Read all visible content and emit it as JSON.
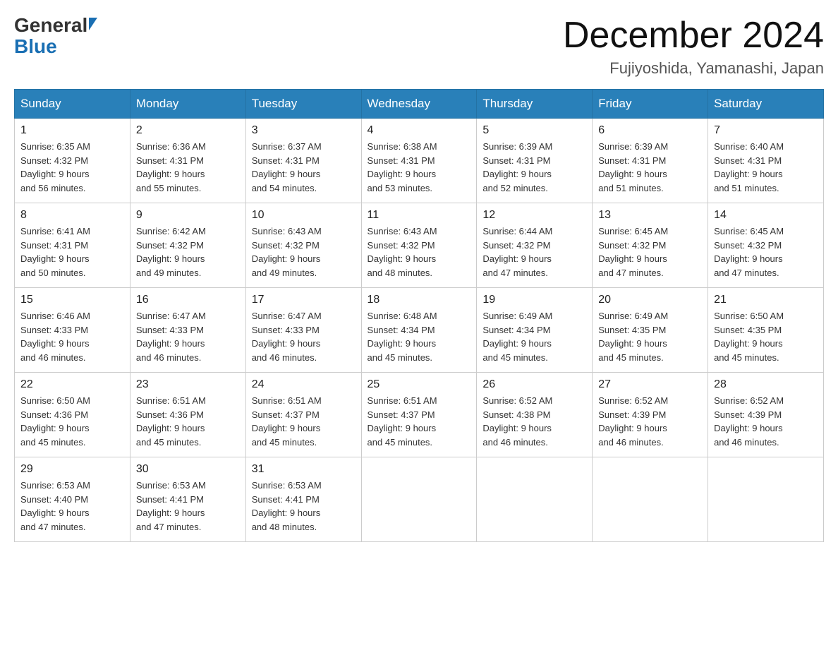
{
  "logo": {
    "general": "General",
    "blue": "Blue"
  },
  "title": {
    "month": "December 2024",
    "location": "Fujiyoshida, Yamanashi, Japan"
  },
  "days_of_week": [
    "Sunday",
    "Monday",
    "Tuesday",
    "Wednesday",
    "Thursday",
    "Friday",
    "Saturday"
  ],
  "weeks": [
    [
      {
        "day": "1",
        "sunrise": "6:35 AM",
        "sunset": "4:32 PM",
        "daylight": "9 hours and 56 minutes."
      },
      {
        "day": "2",
        "sunrise": "6:36 AM",
        "sunset": "4:31 PM",
        "daylight": "9 hours and 55 minutes."
      },
      {
        "day": "3",
        "sunrise": "6:37 AM",
        "sunset": "4:31 PM",
        "daylight": "9 hours and 54 minutes."
      },
      {
        "day": "4",
        "sunrise": "6:38 AM",
        "sunset": "4:31 PM",
        "daylight": "9 hours and 53 minutes."
      },
      {
        "day": "5",
        "sunrise": "6:39 AM",
        "sunset": "4:31 PM",
        "daylight": "9 hours and 52 minutes."
      },
      {
        "day": "6",
        "sunrise": "6:39 AM",
        "sunset": "4:31 PM",
        "daylight": "9 hours and 51 minutes."
      },
      {
        "day": "7",
        "sunrise": "6:40 AM",
        "sunset": "4:31 PM",
        "daylight": "9 hours and 51 minutes."
      }
    ],
    [
      {
        "day": "8",
        "sunrise": "6:41 AM",
        "sunset": "4:31 PM",
        "daylight": "9 hours and 50 minutes."
      },
      {
        "day": "9",
        "sunrise": "6:42 AM",
        "sunset": "4:32 PM",
        "daylight": "9 hours and 49 minutes."
      },
      {
        "day": "10",
        "sunrise": "6:43 AM",
        "sunset": "4:32 PM",
        "daylight": "9 hours and 49 minutes."
      },
      {
        "day": "11",
        "sunrise": "6:43 AM",
        "sunset": "4:32 PM",
        "daylight": "9 hours and 48 minutes."
      },
      {
        "day": "12",
        "sunrise": "6:44 AM",
        "sunset": "4:32 PM",
        "daylight": "9 hours and 47 minutes."
      },
      {
        "day": "13",
        "sunrise": "6:45 AM",
        "sunset": "4:32 PM",
        "daylight": "9 hours and 47 minutes."
      },
      {
        "day": "14",
        "sunrise": "6:45 AM",
        "sunset": "4:32 PM",
        "daylight": "9 hours and 47 minutes."
      }
    ],
    [
      {
        "day": "15",
        "sunrise": "6:46 AM",
        "sunset": "4:33 PM",
        "daylight": "9 hours and 46 minutes."
      },
      {
        "day": "16",
        "sunrise": "6:47 AM",
        "sunset": "4:33 PM",
        "daylight": "9 hours and 46 minutes."
      },
      {
        "day": "17",
        "sunrise": "6:47 AM",
        "sunset": "4:33 PM",
        "daylight": "9 hours and 46 minutes."
      },
      {
        "day": "18",
        "sunrise": "6:48 AM",
        "sunset": "4:34 PM",
        "daylight": "9 hours and 45 minutes."
      },
      {
        "day": "19",
        "sunrise": "6:49 AM",
        "sunset": "4:34 PM",
        "daylight": "9 hours and 45 minutes."
      },
      {
        "day": "20",
        "sunrise": "6:49 AM",
        "sunset": "4:35 PM",
        "daylight": "9 hours and 45 minutes."
      },
      {
        "day": "21",
        "sunrise": "6:50 AM",
        "sunset": "4:35 PM",
        "daylight": "9 hours and 45 minutes."
      }
    ],
    [
      {
        "day": "22",
        "sunrise": "6:50 AM",
        "sunset": "4:36 PM",
        "daylight": "9 hours and 45 minutes."
      },
      {
        "day": "23",
        "sunrise": "6:51 AM",
        "sunset": "4:36 PM",
        "daylight": "9 hours and 45 minutes."
      },
      {
        "day": "24",
        "sunrise": "6:51 AM",
        "sunset": "4:37 PM",
        "daylight": "9 hours and 45 minutes."
      },
      {
        "day": "25",
        "sunrise": "6:51 AM",
        "sunset": "4:37 PM",
        "daylight": "9 hours and 45 minutes."
      },
      {
        "day": "26",
        "sunrise": "6:52 AM",
        "sunset": "4:38 PM",
        "daylight": "9 hours and 46 minutes."
      },
      {
        "day": "27",
        "sunrise": "6:52 AM",
        "sunset": "4:39 PM",
        "daylight": "9 hours and 46 minutes."
      },
      {
        "day": "28",
        "sunrise": "6:52 AM",
        "sunset": "4:39 PM",
        "daylight": "9 hours and 46 minutes."
      }
    ],
    [
      {
        "day": "29",
        "sunrise": "6:53 AM",
        "sunset": "4:40 PM",
        "daylight": "9 hours and 47 minutes."
      },
      {
        "day": "30",
        "sunrise": "6:53 AM",
        "sunset": "4:41 PM",
        "daylight": "9 hours and 47 minutes."
      },
      {
        "day": "31",
        "sunrise": "6:53 AM",
        "sunset": "4:41 PM",
        "daylight": "9 hours and 48 minutes."
      },
      null,
      null,
      null,
      null
    ]
  ],
  "labels": {
    "sunrise": "Sunrise:",
    "sunset": "Sunset:",
    "daylight": "Daylight:"
  }
}
